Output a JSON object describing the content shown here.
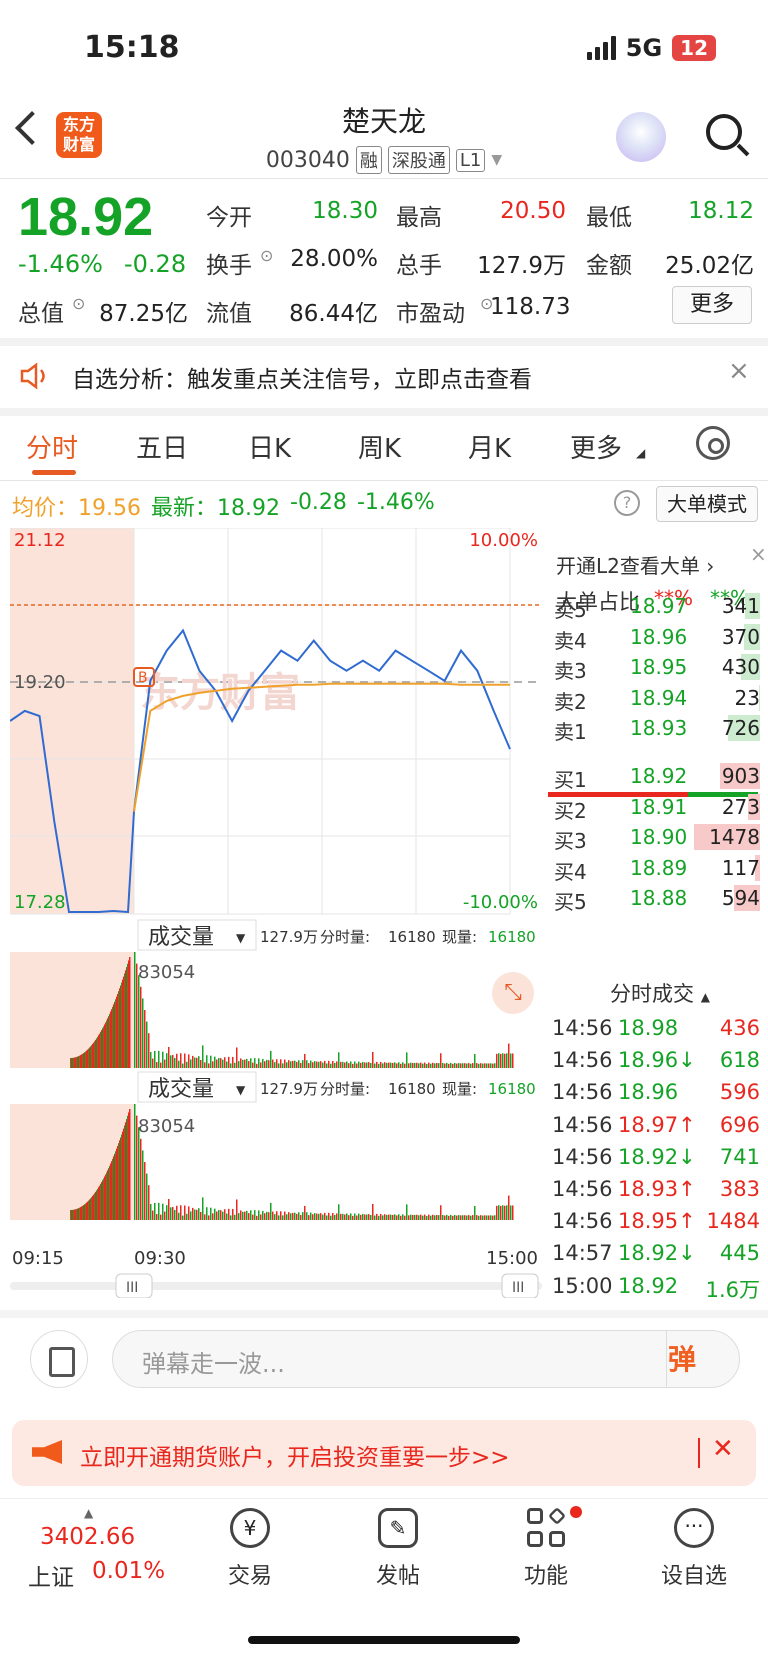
{
  "status": {
    "time": "15:18",
    "network": "5G",
    "battery": "12"
  },
  "header": {
    "logo": "东方财富",
    "name": "楚天龙",
    "code": "003040",
    "tags": [
      "融",
      "深股通",
      "L1"
    ]
  },
  "quote": {
    "price": "18.92",
    "change_pct": "-1.46%",
    "change": "-0.28",
    "fields": [
      {
        "label": "今开",
        "value": "18.30",
        "color": "green"
      },
      {
        "label": "最高",
        "value": "20.50",
        "color": "red"
      },
      {
        "label": "最低",
        "value": "18.12",
        "color": "green"
      },
      {
        "label": "换手",
        "value": "28.00%",
        "color": "dark"
      },
      {
        "label": "总手",
        "value": "127.9万",
        "color": "dark"
      },
      {
        "label": "金额",
        "value": "25.02亿",
        "color": "dark"
      },
      {
        "label": "总值",
        "value": "87.25亿",
        "color": "dark"
      },
      {
        "label": "流值",
        "value": "86.44亿",
        "color": "dark"
      },
      {
        "label": "市盈动",
        "value": "118.73",
        "color": "dark"
      }
    ],
    "more_label": "更多"
  },
  "notice": {
    "text": "自选分析：触发重点关注信号，立即点击查看"
  },
  "tabs": [
    "分时",
    "五日",
    "日K",
    "周K",
    "月K",
    "更多"
  ],
  "avg_row": {
    "avg_label": "均价：",
    "avg_value": "19.56",
    "latest_label": "最新：",
    "latest_value": "18.92",
    "change": "-0.28",
    "change_pct": "-1.46%",
    "big_order_label": "大单模式"
  },
  "chart_data": {
    "type": "line",
    "ylim": [
      17.28,
      21.12
    ],
    "y_ticks": [
      "21.12",
      "19.20",
      "17.28"
    ],
    "pct_ticks": [
      "10.00%",
      "-10.00%"
    ],
    "x_ticks": [
      "09:15",
      "09:30",
      "15:00"
    ],
    "series": [
      {
        "name": "price",
        "values": [
          19.2,
          19.3,
          19.25,
          18.2,
          17.3,
          17.3,
          17.3,
          17.31,
          17.3,
          18.3,
          19.6,
          19.9,
          20.1,
          19.7,
          19.5,
          19.2,
          19.5,
          19.7,
          19.9,
          19.8,
          20.0,
          19.8,
          19.7,
          19.8,
          19.7,
          19.9,
          19.8,
          19.7,
          19.6,
          19.9,
          19.7,
          19.3,
          18.92
        ]
      },
      {
        "name": "avg",
        "values": [
          null,
          null,
          null,
          null,
          null,
          null,
          null,
          null,
          null,
          18.3,
          19.3,
          19.4,
          19.45,
          19.48,
          19.5,
          19.52,
          19.53,
          19.54,
          19.55,
          19.56,
          19.56,
          19.57,
          19.57,
          19.57,
          19.57,
          19.57,
          19.57,
          19.57,
          19.57,
          19.56,
          19.56,
          19.56,
          19.56
        ]
      }
    ]
  },
  "volume_panel": {
    "label": "成交量",
    "total": "127.9万",
    "minute_label": "分时量:",
    "minute_value": "16180",
    "now_label": "现量:",
    "now_value": "16180",
    "peak": "83054"
  },
  "order_book": {
    "l2_link": "开通L2查看大单",
    "big_ratio_label": "大单占比",
    "big_ratio_buy": "**%",
    "big_ratio_sell": "**%",
    "asks": [
      {
        "label": "卖5",
        "price": "18.97",
        "vol": "341",
        "ratio": 0.23
      },
      {
        "label": "卖4",
        "price": "18.96",
        "vol": "370",
        "ratio": 0.25
      },
      {
        "label": "卖3",
        "price": "18.95",
        "vol": "430",
        "ratio": 0.29
      },
      {
        "label": "卖2",
        "price": "18.94",
        "vol": "23",
        "ratio": 0.02
      },
      {
        "label": "卖1",
        "price": "18.93",
        "vol": "726",
        "ratio": 0.49
      }
    ],
    "bids": [
      {
        "label": "买1",
        "price": "18.92",
        "vol": "903",
        "ratio": 0.61
      },
      {
        "label": "买2",
        "price": "18.91",
        "vol": "273",
        "ratio": 0.18
      },
      {
        "label": "买3",
        "price": "18.90",
        "vol": "1478",
        "ratio": 1.0
      },
      {
        "label": "买4",
        "price": "18.89",
        "vol": "117",
        "ratio": 0.08
      },
      {
        "label": "买5",
        "price": "18.88",
        "vol": "594",
        "ratio": 0.4
      }
    ],
    "ticks_title": "分时成交",
    "ticks": [
      {
        "time": "14:56",
        "price": "18.98",
        "vol": "436",
        "dir": "",
        "color": "red"
      },
      {
        "time": "14:56",
        "price": "18.96↓",
        "vol": "618",
        "dir": "down",
        "color": "green"
      },
      {
        "time": "14:56",
        "price": "18.96",
        "vol": "596",
        "dir": "",
        "color": "red"
      },
      {
        "time": "14:56",
        "price": "18.97↑",
        "vol": "696",
        "dir": "up",
        "color": "red"
      },
      {
        "time": "14:56",
        "price": "18.92↓",
        "vol": "741",
        "dir": "down",
        "color": "green"
      },
      {
        "time": "14:56",
        "price": "18.93↑",
        "vol": "383",
        "dir": "up",
        "color": "red"
      },
      {
        "time": "14:56",
        "price": "18.95↑",
        "vol": "1484",
        "dir": "up",
        "color": "red"
      },
      {
        "time": "14:57",
        "price": "18.92↓",
        "vol": "445",
        "dir": "down",
        "color": "green"
      },
      {
        "time": "15:00",
        "price": "18.92",
        "vol": "1.6万",
        "dir": "",
        "color": "green"
      }
    ]
  },
  "comment": {
    "placeholder": "弹幕走一波...",
    "danmu": "弹"
  },
  "ad": {
    "text": "立即开通期货账户，开启投资重要一步>>"
  },
  "nav": {
    "index_value": "3402.66",
    "index_name": "上证",
    "index_change": "0.01%",
    "items": [
      "交易",
      "发帖",
      "功能",
      "设自选"
    ]
  },
  "colors": {
    "up": "#e8271e",
    "down": "#14a326",
    "line": "#2f6bd1",
    "avg": "#f0a12b",
    "accent": "#e85a23"
  }
}
